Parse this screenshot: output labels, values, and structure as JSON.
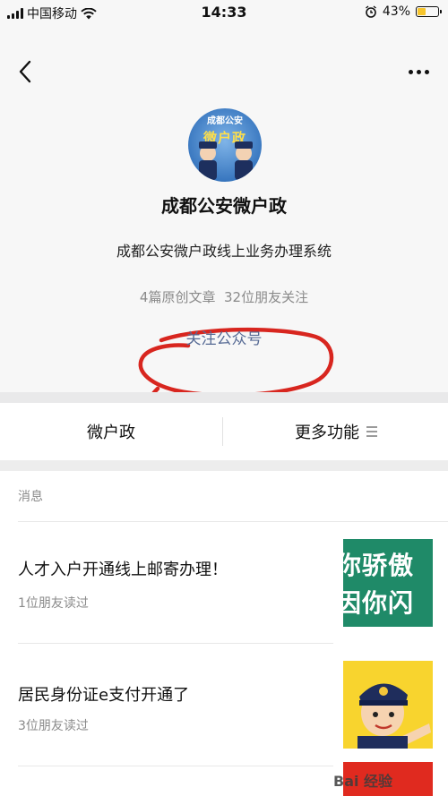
{
  "status_bar": {
    "carrier": "中国移动",
    "time": "14:33",
    "battery_percent": "43%",
    "battery_level": 0.43,
    "icons": [
      "signal-icon",
      "wifi-icon",
      "alarm-icon",
      "battery-icon"
    ]
  },
  "nav": {
    "back_icon": "chevron-left-icon",
    "more_icon": "more-dots-icon"
  },
  "profile": {
    "avatar_text_top": "成都公安",
    "avatar_text_big": "微户政",
    "name": "成都公安微户政",
    "description": "成都公安微户政线上业务办理系统",
    "stats": "4篇原创文章  32位朋友关注",
    "follow_label": "关注公众号"
  },
  "tabs": [
    {
      "label": "微户政"
    },
    {
      "label": "更多功能",
      "icon": "menu-icon"
    }
  ],
  "messages": {
    "header": "消息",
    "items": [
      {
        "title": "人才入户开通线上邮寄办理！",
        "meta": "1位朋友读过",
        "thumb_text": [
          "你骄傲",
          "因你闪"
        ]
      },
      {
        "title": "居民身份证e支付开通了",
        "meta": "3位朋友读过"
      }
    ]
  },
  "watermark": "Bai 经验",
  "colors": {
    "link_blue": "#576b95",
    "annotation_red": "#d8261f",
    "battery_yellow": "#f6c52c",
    "thumb_green": "#1f8a68",
    "thumb_yellow": "#f8d42e"
  }
}
